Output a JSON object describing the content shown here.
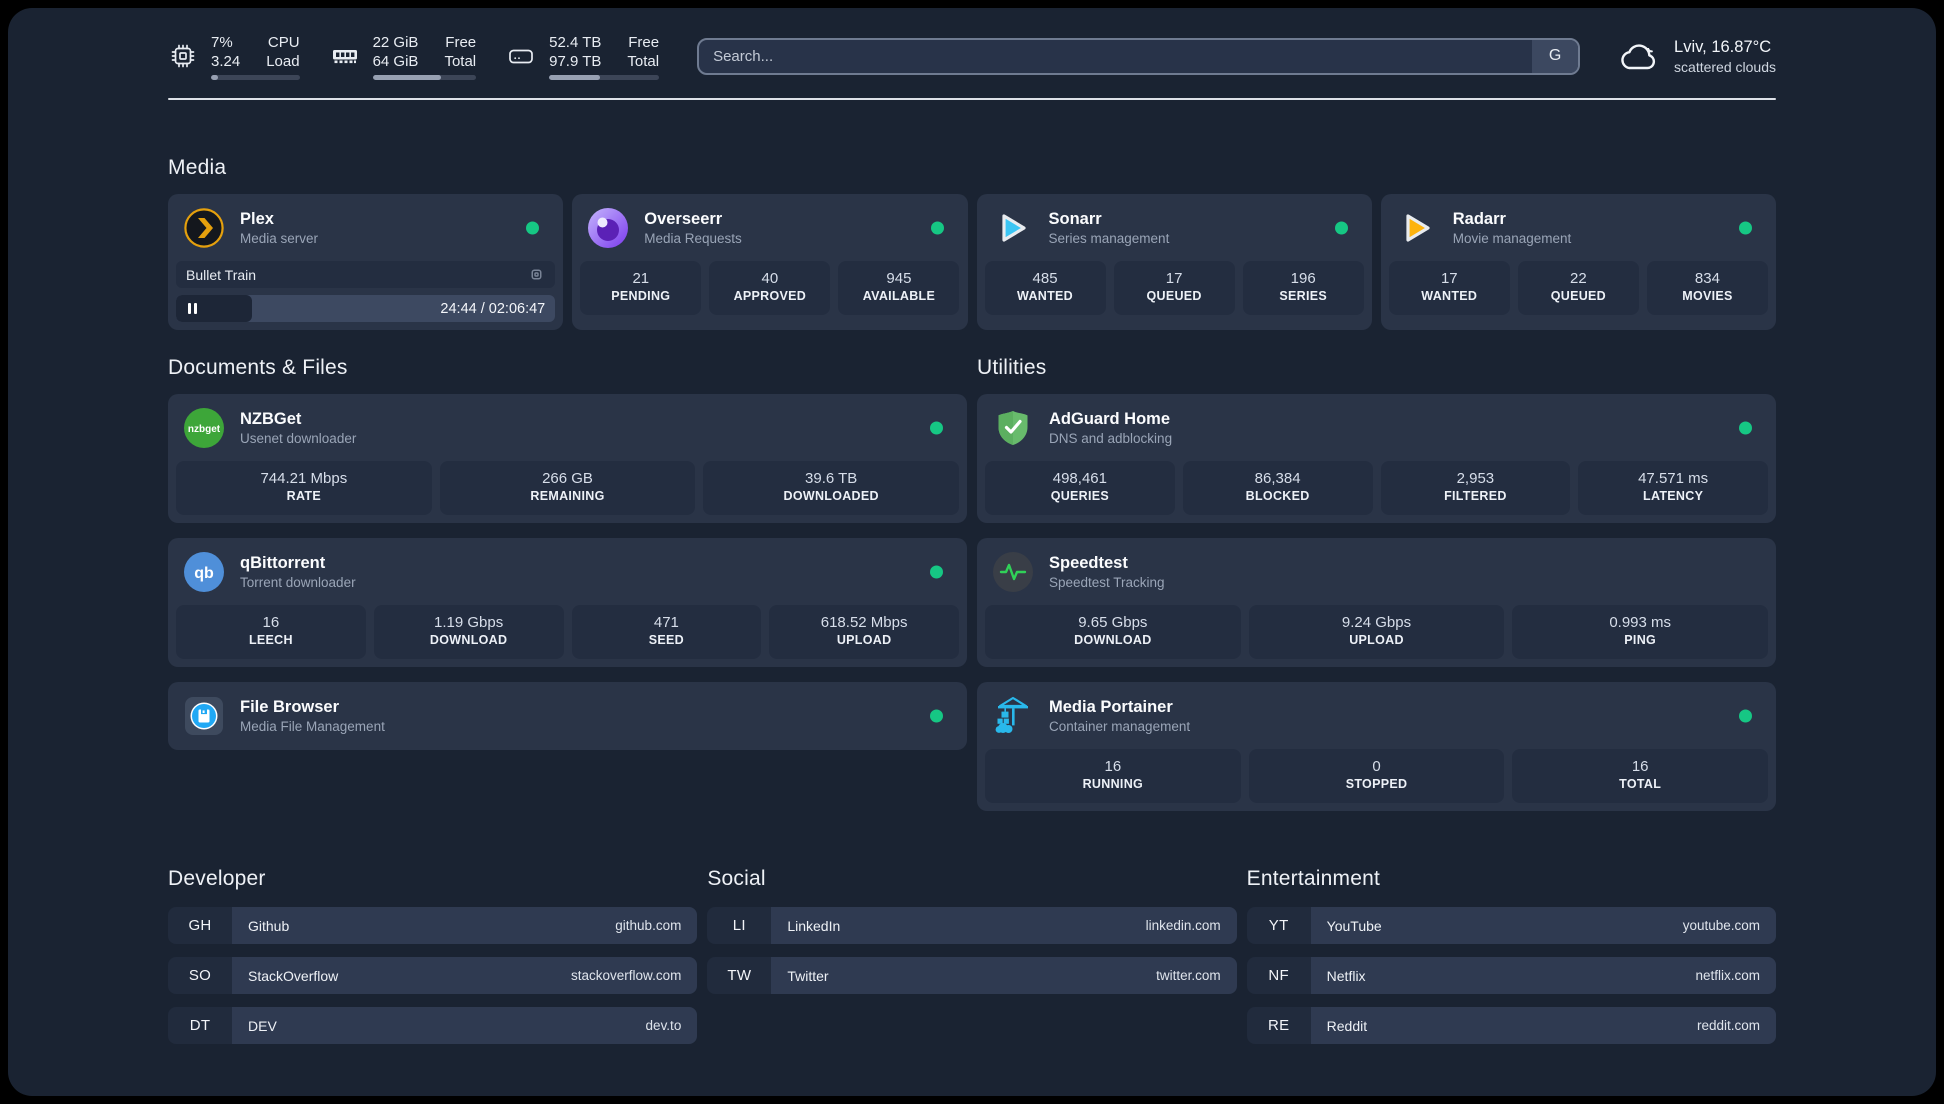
{
  "topbar": {
    "cpu": {
      "value_top": "7%",
      "value_bottom": "3.24",
      "label_top": "CPU",
      "label_bottom": "Load",
      "progress_pct": 8
    },
    "memory": {
      "value_top": "22 GiB",
      "value_bottom": "64 GiB",
      "label_top": "Free",
      "label_bottom": "Total",
      "progress_pct": 66
    },
    "disk": {
      "value_top": "52.4 TB",
      "value_bottom": "97.9 TB",
      "label_top": "Free",
      "label_bottom": "Total",
      "progress_pct": 46
    },
    "search": {
      "placeholder": "Search...",
      "provider_button": "G"
    },
    "weather": {
      "location": "Lviv, 16.87°C",
      "condition": "scattered clouds"
    }
  },
  "sections": {
    "media": "Media",
    "documents": "Documents & Files",
    "utilities": "Utilities",
    "developer": "Developer",
    "social": "Social",
    "entertainment": "Entertainment"
  },
  "services": {
    "plex": {
      "name": "Plex",
      "description": "Media server",
      "now_playing": {
        "title": "Bullet Train",
        "time": "24:44 / 02:06:47",
        "progress_pct": 20
      }
    },
    "overseerr": {
      "name": "Overseerr",
      "description": "Media Requests",
      "stats": [
        {
          "value": "21",
          "label": "PENDING"
        },
        {
          "value": "40",
          "label": "APPROVED"
        },
        {
          "value": "945",
          "label": "AVAILABLE"
        }
      ]
    },
    "sonarr": {
      "name": "Sonarr",
      "description": "Series management",
      "stats": [
        {
          "value": "485",
          "label": "WANTED"
        },
        {
          "value": "17",
          "label": "QUEUED"
        },
        {
          "value": "196",
          "label": "SERIES"
        }
      ]
    },
    "radarr": {
      "name": "Radarr",
      "description": "Movie management",
      "stats": [
        {
          "value": "17",
          "label": "WANTED"
        },
        {
          "value": "22",
          "label": "QUEUED"
        },
        {
          "value": "834",
          "label": "MOVIES"
        }
      ]
    },
    "nzbget": {
      "name": "NZBGet",
      "description": "Usenet downloader",
      "icon_text": "nzbget",
      "stats": [
        {
          "value": "744.21 Mbps",
          "label": "RATE"
        },
        {
          "value": "266 GB",
          "label": "REMAINING"
        },
        {
          "value": "39.6 TB",
          "label": "DOWNLOADED"
        }
      ]
    },
    "qbittorrent": {
      "name": "qBittorrent",
      "description": "Torrent downloader",
      "icon_text": "qb",
      "stats": [
        {
          "value": "16",
          "label": "LEECH"
        },
        {
          "value": "1.19 Gbps",
          "label": "DOWNLOAD"
        },
        {
          "value": "471",
          "label": "SEED"
        },
        {
          "value": "618.52 Mbps",
          "label": "UPLOAD"
        }
      ]
    },
    "filebrowser": {
      "name": "File Browser",
      "description": "Media File Management"
    },
    "adguard": {
      "name": "AdGuard Home",
      "description": "DNS and adblocking",
      "stats": [
        {
          "value": "498,461",
          "label": "QUERIES"
        },
        {
          "value": "86,384",
          "label": "BLOCKED"
        },
        {
          "value": "2,953",
          "label": "FILTERED"
        },
        {
          "value": "47.571 ms",
          "label": "LATENCY"
        }
      ]
    },
    "speedtest": {
      "name": "Speedtest",
      "description": "Speedtest Tracking",
      "stats": [
        {
          "value": "9.65 Gbps",
          "label": "DOWNLOAD"
        },
        {
          "value": "9.24 Gbps",
          "label": "UPLOAD"
        },
        {
          "value": "0.993 ms",
          "label": "PING"
        }
      ]
    },
    "portainer": {
      "name": "Media Portainer",
      "description": "Container management",
      "stats": [
        {
          "value": "16",
          "label": "RUNNING"
        },
        {
          "value": "0",
          "label": "STOPPED"
        },
        {
          "value": "16",
          "label": "TOTAL"
        }
      ]
    }
  },
  "bookmarks": {
    "developer": [
      {
        "abbr": "GH",
        "name": "Github",
        "domain": "github.com"
      },
      {
        "abbr": "SO",
        "name": "StackOverflow",
        "domain": "stackoverflow.com"
      },
      {
        "abbr": "DT",
        "name": "DEV",
        "domain": "dev.to"
      }
    ],
    "social": [
      {
        "abbr": "LI",
        "name": "LinkedIn",
        "domain": "linkedin.com"
      },
      {
        "abbr": "TW",
        "name": "Twitter",
        "domain": "twitter.com"
      }
    ],
    "entertainment": [
      {
        "abbr": "YT",
        "name": "YouTube",
        "domain": "youtube.com"
      },
      {
        "abbr": "NF",
        "name": "Netflix",
        "domain": "netflix.com"
      },
      {
        "abbr": "RE",
        "name": "Reddit",
        "domain": "reddit.com"
      }
    ]
  },
  "colors": {
    "accent_green": "#16c784",
    "page_bg": "#1a2332",
    "card_bg": "#2a3447"
  }
}
